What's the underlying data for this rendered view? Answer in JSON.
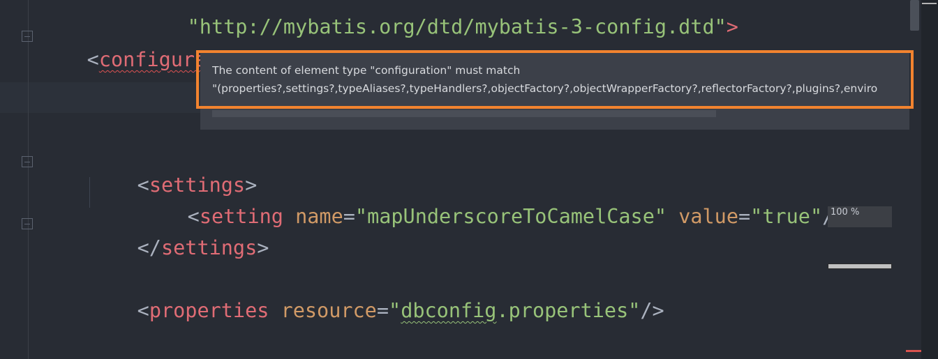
{
  "code": {
    "line_doctype": {
      "string": "\"http://mybatis.org/dtd/mybatis-3-config.dtd\"",
      "close": ">"
    },
    "line_configuration": {
      "open": "<",
      "tag": "configuration",
      "close": ">"
    },
    "line_settings_open": {
      "open": "<",
      "tag": "settings",
      "close": ">"
    },
    "line_setting": {
      "open": "<",
      "tag": "setting",
      "attr1": "name",
      "eq1": "=",
      "val1": "\"mapUnderscoreToCamelCase\"",
      "attr2": "value",
      "eq2": "=",
      "val2": "\"true\"",
      "close": "/>"
    },
    "line_settings_close": {
      "open": "</",
      "tag": "settings",
      "close": ">"
    },
    "line_properties": {
      "open": "<",
      "tag": "properties",
      "attr": "resource",
      "eq": "=",
      "q1": "\"",
      "val_underlined": "dbconfig",
      "val_rest": ".properties\"",
      "close": "/>"
    }
  },
  "tooltip": {
    "line1": "The content of element type \"configuration\" must match",
    "line2": "\"(properties?,settings?,typeAliases?,typeHandlers?,objectFactory?,objectWrapperFactory?,reflectorFactory?,plugins?,enviro"
  },
  "zoom": {
    "label": "100 %"
  },
  "colors": {
    "background": "#282c34",
    "tag": "#e06c75",
    "attribute": "#d19a66",
    "string": "#98c379",
    "highlight_border": "#f2832f"
  }
}
